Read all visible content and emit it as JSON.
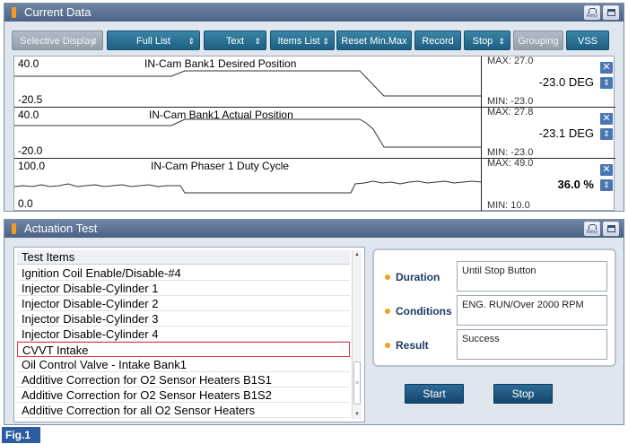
{
  "current_data": {
    "title": "Current Data",
    "retry_label": "Retry",
    "toolbar": [
      {
        "label": "Selective Display",
        "dropdown": true,
        "enabled": false
      },
      {
        "label": "Full List",
        "dropdown": true,
        "enabled": true
      },
      {
        "label": "Text",
        "dropdown": true,
        "enabled": true
      },
      {
        "label": "Items List",
        "dropdown": true,
        "enabled": true
      },
      {
        "label": "Reset Min.Max",
        "dropdown": false,
        "enabled": true
      },
      {
        "label": "Record",
        "dropdown": false,
        "enabled": true
      },
      {
        "label": "Stop",
        "dropdown": true,
        "enabled": true
      },
      {
        "label": "Grouping",
        "dropdown": false,
        "enabled": false
      },
      {
        "label": "VSS",
        "dropdown": false,
        "enabled": true
      }
    ],
    "graphs": [
      {
        "title": "IN-Cam Bank1 Desired Position",
        "top": "40.0",
        "bottom": "-20.5",
        "max": "MAX: 27.0",
        "current": "-23.0 DEG",
        "min": "MIN: -23.0"
      },
      {
        "title": "IN-Cam Bank1 Actual Position",
        "top": "40.0",
        "bottom": "-20.0",
        "max": "MAX: 27.8",
        "current": "-23.1 DEG",
        "min": "MIN: -23.0"
      },
      {
        "title": "IN-Cam Phaser 1 Duty Cycle",
        "top": "100.0",
        "bottom": "0.0",
        "max": "MAX: 49.0",
        "current": "36.0 %",
        "min": "MIN: 10.0"
      }
    ]
  },
  "actuation_test": {
    "title": "Actuation Test",
    "retry_label": "Retry",
    "list_header": "Test Items",
    "items": [
      "Ignition Coil Enable/Disable-#4",
      "Injector Disable-Cylinder 1",
      "Injector Disable-Cylinder 2",
      "Injector Disable-Cylinder 3",
      "Injector Disable-Cylinder 4",
      "CVVT Intake",
      "Oil Control Valve - Intake Bank1",
      "Additive Correction for O2 Sensor Heaters B1S1",
      "Additive Correction for O2 Sensor Heaters B1S2",
      "Additive Correction for all O2 Sensor Heaters"
    ],
    "selected_index": 5,
    "info": [
      {
        "label": "Duration",
        "value": "Until Stop Button"
      },
      {
        "label": "Conditions",
        "value": "ENG. RUN/Over 2000 RPM"
      },
      {
        "label": "Result",
        "value": "Success"
      }
    ],
    "start_label": "Start",
    "stop_label": "Stop"
  },
  "figure_label": "Fig.1",
  "colors": {
    "title_bar": "#5a7396",
    "toolbar_button": "#2a72979",
    "selection_border": "#e0393a",
    "accent_dot": "#f0a21c"
  }
}
